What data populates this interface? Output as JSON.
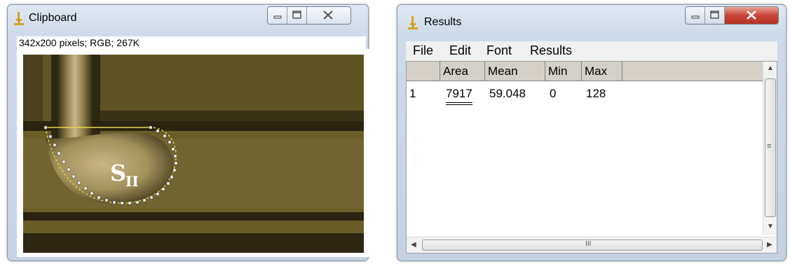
{
  "clipboard": {
    "title": "Clipboard",
    "status": "342x200 pixels; RGB; 267K",
    "overlay_label": "S",
    "overlay_subscript": "II"
  },
  "results": {
    "title": "Results",
    "menu": [
      "File",
      "Edit",
      "Font",
      "Results"
    ],
    "columns": [
      "",
      "Area",
      "Mean",
      "Min",
      "Max"
    ],
    "rows": [
      [
        "1",
        "7917",
        "59.048",
        "0",
        "128"
      ]
    ],
    "scrollbar_grip": "≡",
    "hscroll_grip": "III"
  },
  "icons": {
    "app": "imagej-microscope-icon",
    "minimize": "minimize-icon",
    "maximize": "maximize-icon",
    "close": "close-icon"
  },
  "colors": {
    "image_olive": "#6a5e28",
    "selection_yellow": "#e5d64a",
    "close_red": "#c8453a"
  }
}
